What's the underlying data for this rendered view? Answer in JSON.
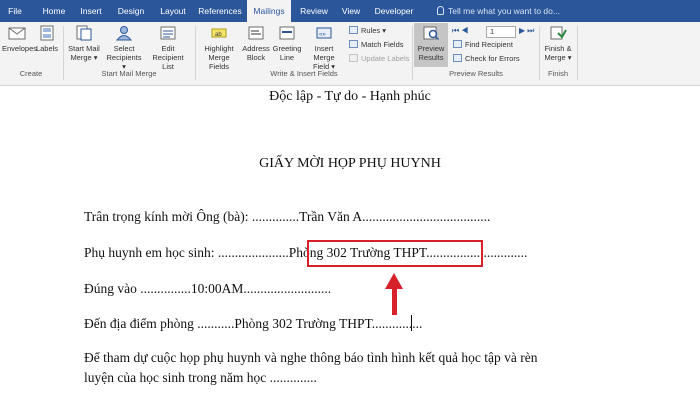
{
  "tabs": [
    "File",
    "Home",
    "Insert",
    "Design",
    "Layout",
    "References",
    "Mailings",
    "Review",
    "View",
    "Developer"
  ],
  "active_tab": "Mailings",
  "tell_me": "Tell me what you want to do...",
  "ribbon": {
    "create": {
      "envelopes": "Envelopes",
      "labels": "Labels",
      "group": "Create"
    },
    "start_mail_merge": {
      "start": [
        "Start Mail",
        "Merge ▾"
      ],
      "select": [
        "Select",
        "Recipients ▾"
      ],
      "edit": [
        "Edit",
        "Recipient List"
      ],
      "group": "Start Mail Merge"
    },
    "write_insert": {
      "highlight": [
        "Highlight",
        "Merge Fields"
      ],
      "address": [
        "Address",
        "Block"
      ],
      "greeting": [
        "Greeting",
        "Line"
      ],
      "insert_field": [
        "Insert Merge",
        "Field ▾"
      ],
      "rules": "Rules ▾",
      "match_fields": "Match Fields",
      "update_labels": "Update Labels",
      "group": "Write & Insert Fields"
    },
    "preview": {
      "preview_results": [
        "Preview",
        "Results"
      ],
      "record_number": "1",
      "find_recipient": "Find Recipient",
      "check_errors": "Check for Errors",
      "group": "Preview Results"
    },
    "finish": {
      "finish_merge": [
        "Finish &",
        "Merge ▾"
      ],
      "group": "Finish"
    }
  },
  "document": {
    "motto": "Độc lập - Tự do - Hạnh phúc",
    "title": "GIẤY MỜI HỌP PHỤ HUYNH",
    "line1": "Trân trọng kính mời Ông (bà): ..............Trần Văn A......................................",
    "line2_label": "Phụ huynh em học sinh: ...................",
    "line2_value": "..Phòng 302 Trường THPT",
    "line2_tail": "..............................",
    "line3": "Đúng vào ...............10:00AM..........................",
    "line4": "Đến địa điểm phòng ...........Phòng 302 Trường THPT...............",
    "line5a": "Để tham dự cuộc họp phụ huynh và nghe thông báo tình hình kết quả học tập và rèn",
    "line5b": "luyện của học sinh trong năm học .............."
  },
  "colors": {
    "accent": "#2b579a",
    "highlight": "#d6202a"
  }
}
